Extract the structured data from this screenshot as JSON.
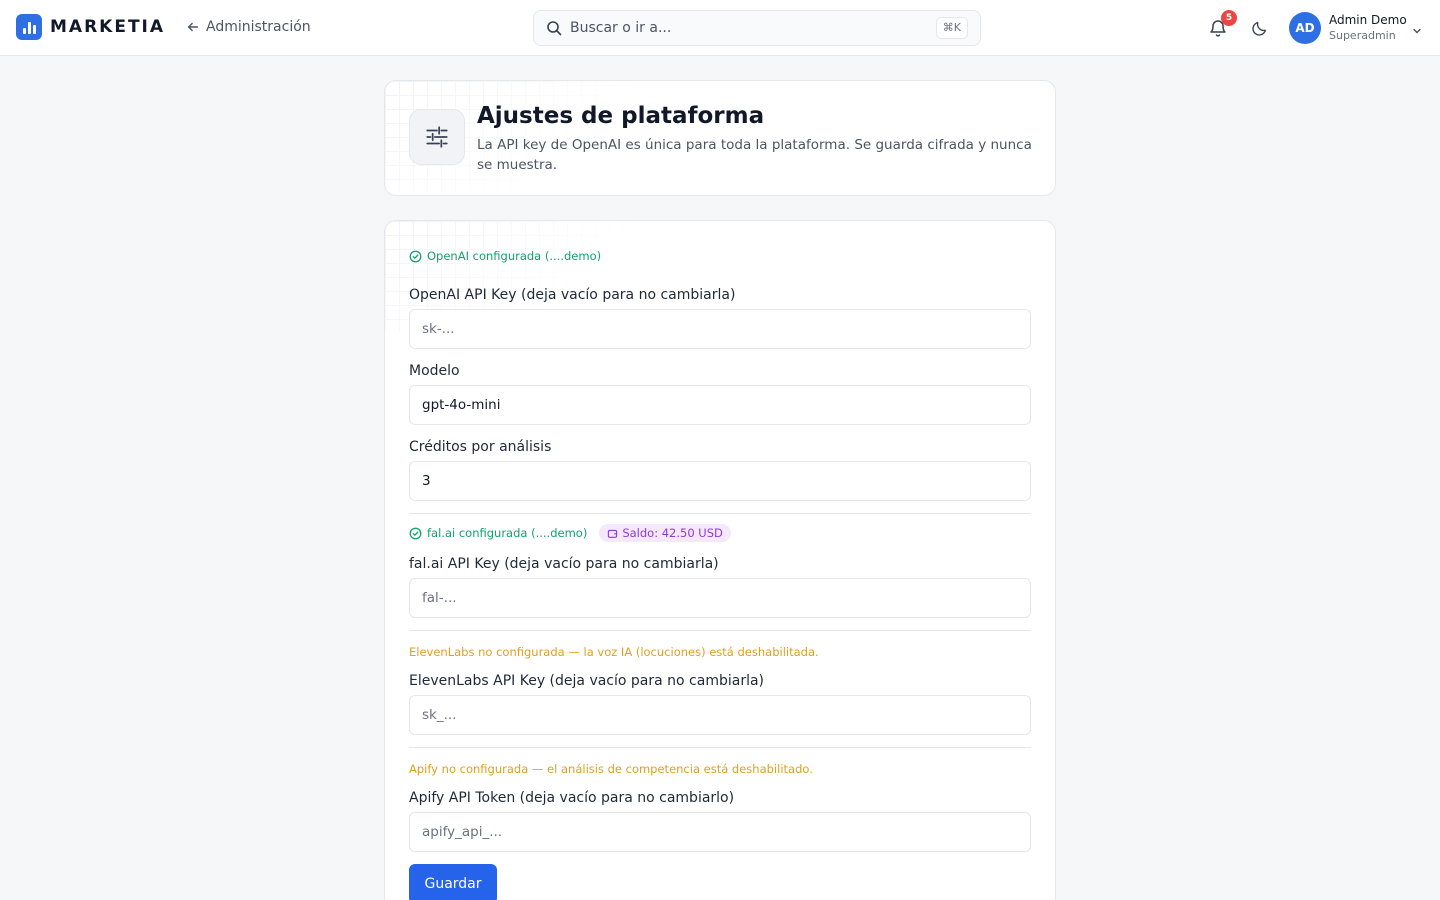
{
  "app": {
    "brand": "MARKETIA",
    "back_label": "Administración",
    "search_placeholder": "Buscar o ir a...",
    "search_shortcut": "⌘K",
    "notification_count": "5",
    "user": {
      "initials": "AD",
      "name": "Admin Demo",
      "role": "Superadmin"
    },
    "accent_color": "#2f6fe4"
  },
  "header": {
    "title": "Ajustes de plataforma",
    "description": "La API key de OpenAI es única para toda la plataforma. Se guarda cifrada y nunca se muestra."
  },
  "form": {
    "openai": {
      "status": "OpenAI configurada (....demo)",
      "key_label": "OpenAI API Key (deja vacío para no cambiarla)",
      "key_placeholder": "sk-...",
      "model_label": "Modelo",
      "model_value": "gpt-4o-mini",
      "credits_label": "Créditos por análisis",
      "credits_value": "3"
    },
    "fal": {
      "status": "fal.ai configurada (....demo)",
      "balance": "Saldo: 42.50 USD",
      "key_label": "fal.ai API Key (deja vacío para no cambiarla)",
      "key_placeholder": "fal-..."
    },
    "elevenlabs": {
      "status": "ElevenLabs no configurada — la voz IA (locuciones) está deshabilitada.",
      "key_label": "ElevenLabs API Key (deja vacío para no cambiarla)",
      "key_placeholder": "sk_..."
    },
    "apify": {
      "status": "Apify no configurada — el análisis de competencia está deshabilitado.",
      "key_label": "Apify API Token (deja vacío para no cambiarlo)",
      "key_placeholder": "apify_api_..."
    },
    "save_label": "Guardar"
  }
}
